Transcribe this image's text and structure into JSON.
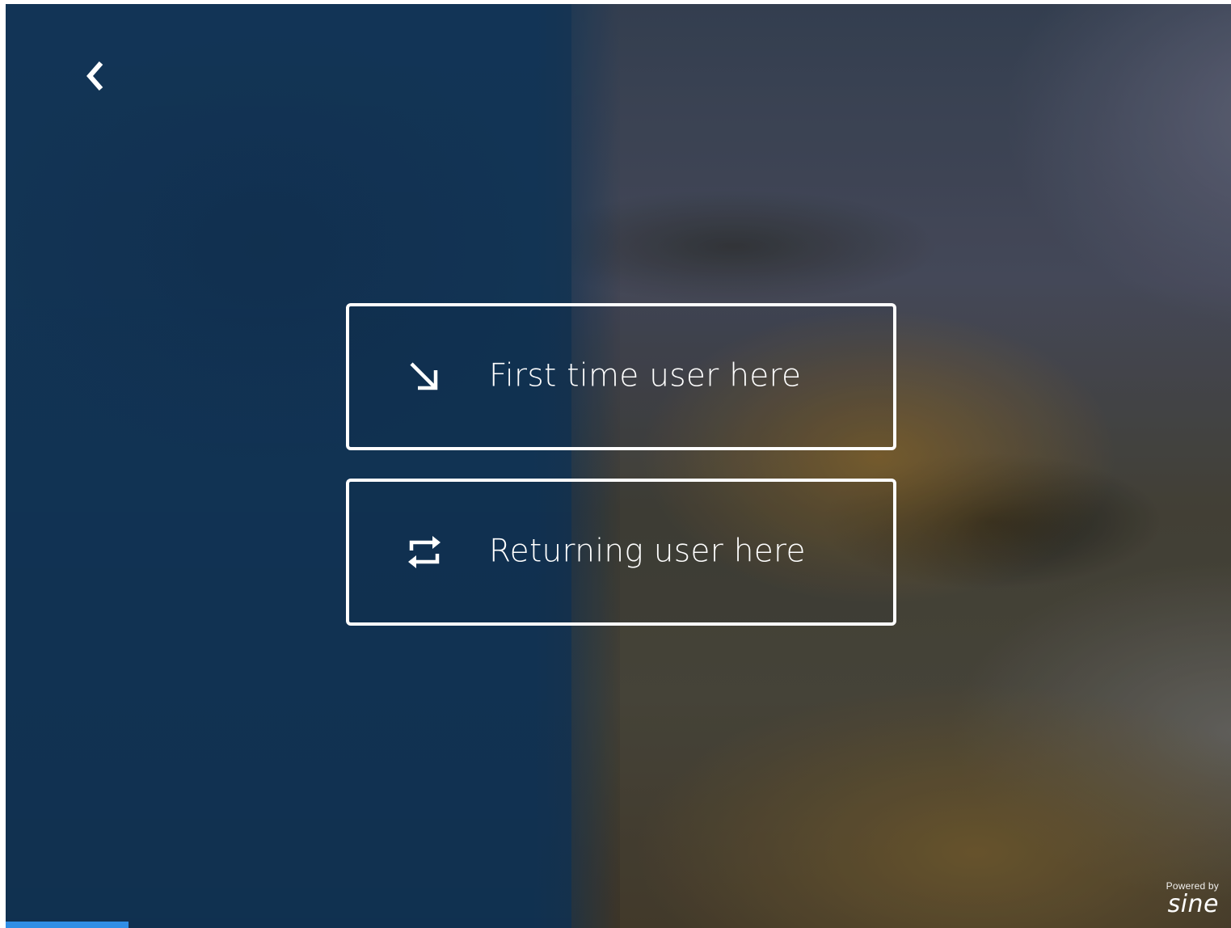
{
  "header": {
    "back_icon": "chevron-left-icon"
  },
  "options": [
    {
      "icon": "arrow-down-right-icon",
      "label": "First time user here"
    },
    {
      "icon": "repeat-icon",
      "label": "Returning user here"
    }
  ],
  "footer": {
    "powered_by": "Powered by",
    "brand": "sine"
  },
  "progress": {
    "fraction": 0.1
  },
  "colors": {
    "accent": "#2f8ee6",
    "left_panel": "#143a5e",
    "text": "#ffffff"
  }
}
